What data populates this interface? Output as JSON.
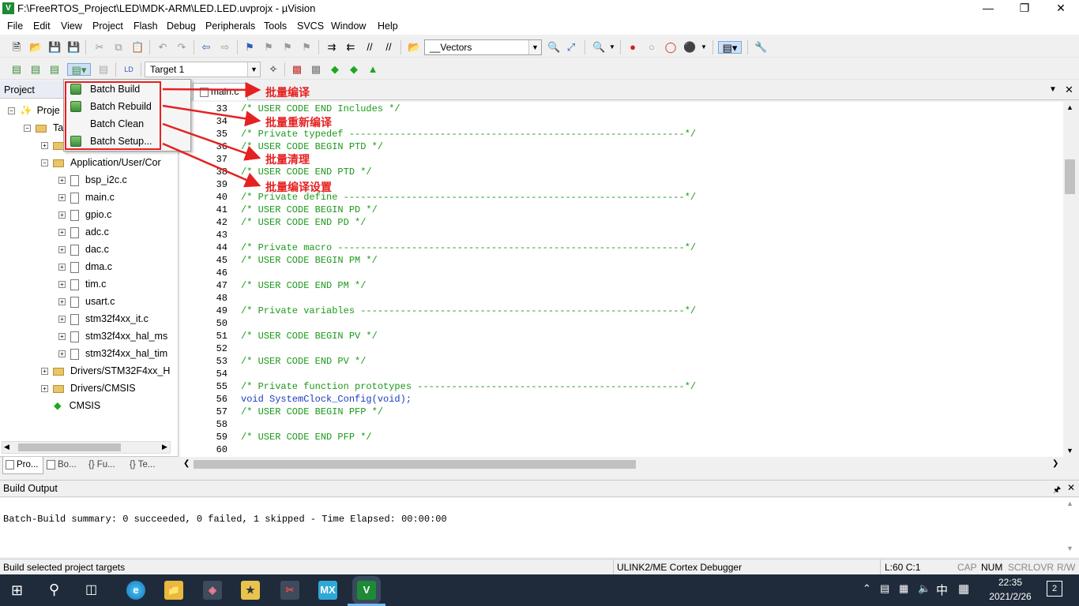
{
  "window": {
    "title": "F:\\FreeRTOS_Project\\LED\\MDK-ARM\\LED.LED.uvprojx - µVision",
    "icon": "V"
  },
  "menu": [
    "File",
    "Edit",
    "View",
    "Project",
    "Flash",
    "Debug",
    "Peripherals",
    "Tools",
    "SVCS",
    "Window",
    "Help"
  ],
  "toolbar1": {
    "vectors_combo": "__Vectors"
  },
  "toolbar2": {
    "target_combo": "Target 1"
  },
  "project_panel": {
    "title": "Project",
    "tree": [
      {
        "label": "Proje",
        "level": 0
      },
      {
        "label": "Ta",
        "level": 1
      },
      {
        "label": "",
        "level": 2
      },
      {
        "label": "Application/User/Cor",
        "level": 2
      },
      {
        "label": "bsp_i2c.c",
        "level": 3
      },
      {
        "label": "main.c",
        "level": 3
      },
      {
        "label": "gpio.c",
        "level": 3
      },
      {
        "label": "adc.c",
        "level": 3
      },
      {
        "label": "dac.c",
        "level": 3
      },
      {
        "label": "dma.c",
        "level": 3
      },
      {
        "label": "tim.c",
        "level": 3
      },
      {
        "label": "usart.c",
        "level": 3
      },
      {
        "label": "stm32f4xx_it.c",
        "level": 3
      },
      {
        "label": "stm32f4xx_hal_ms",
        "level": 3
      },
      {
        "label": "stm32f4xx_hal_tim",
        "level": 3
      },
      {
        "label": "Drivers/STM32F4xx_H",
        "level": 2
      },
      {
        "label": "Drivers/CMSIS",
        "level": 2
      },
      {
        "label": "CMSIS",
        "level": 2
      }
    ],
    "tabs": [
      "Pro...",
      "Bo...",
      "Fu...",
      "Te..."
    ]
  },
  "batch_menu": {
    "items": [
      "Batch Build",
      "Batch Rebuild",
      "Batch Clean",
      "Batch Setup..."
    ]
  },
  "annotations": [
    "批量编译",
    "批量重新编译",
    "批量清理",
    "批量编译设置"
  ],
  "editor": {
    "tab": "main.c",
    "lines": [
      {
        "n": "33",
        "t": "/* USER CODE END Includes */"
      },
      {
        "n": "34",
        "t": ""
      },
      {
        "n": "35",
        "t": "/* Private typedef -----------------------------------------------------------*/"
      },
      {
        "n": "36",
        "t": "/* USER CODE BEGIN PTD */"
      },
      {
        "n": "37",
        "t": ""
      },
      {
        "n": "38",
        "t": "/* USER CODE END PTD */"
      },
      {
        "n": "39",
        "t": ""
      },
      {
        "n": "40",
        "t": "/* Private define ------------------------------------------------------------*/"
      },
      {
        "n": "41",
        "t": "/* USER CODE BEGIN PD */"
      },
      {
        "n": "42",
        "t": "/* USER CODE END PD */"
      },
      {
        "n": "43",
        "t": ""
      },
      {
        "n": "44",
        "t": "/* Private macro -------------------------------------------------------------*/"
      },
      {
        "n": "45",
        "t": "/* USER CODE BEGIN PM */"
      },
      {
        "n": "46",
        "t": ""
      },
      {
        "n": "47",
        "t": "/* USER CODE END PM */"
      },
      {
        "n": "48",
        "t": ""
      },
      {
        "n": "49",
        "t": "/* Private variables ---------------------------------------------------------*/"
      },
      {
        "n": "50",
        "t": ""
      },
      {
        "n": "51",
        "t": "/* USER CODE BEGIN PV */"
      },
      {
        "n": "52",
        "t": ""
      },
      {
        "n": "53",
        "t": "/* USER CODE END PV */"
      },
      {
        "n": "54",
        "t": ""
      },
      {
        "n": "55",
        "t": "/* Private function prototypes -----------------------------------------------*/"
      },
      {
        "n": "56",
        "t": "void SystemClock_Config(void);"
      },
      {
        "n": "57",
        "t": "/* USER CODE BEGIN PFP */"
      },
      {
        "n": "58",
        "t": ""
      },
      {
        "n": "59",
        "t": "/* USER CODE END PFP */"
      },
      {
        "n": "60",
        "t": ""
      }
    ]
  },
  "build_output": {
    "title": "Build Output",
    "text": "Batch-Build summary: 0 succeeded, 0 failed, 1 skipped - Time Elapsed: 00:00:00"
  },
  "status": {
    "left": "Build selected project targets",
    "debugger": "ULINK2/ME Cortex Debugger",
    "position": "L:60 C:1",
    "flags": [
      "CAP",
      "NUM",
      "SCRL",
      "OVR",
      "R/W"
    ]
  },
  "taskbar": {
    "time": "22:35",
    "date": "2021/2/26",
    "ime": "中",
    "notifications": "2",
    "apps": [
      "MX"
    ]
  },
  "colors": {
    "comment": "#1a9a1a",
    "keyword": "#1a3dbf",
    "annotation": "#e52121"
  }
}
